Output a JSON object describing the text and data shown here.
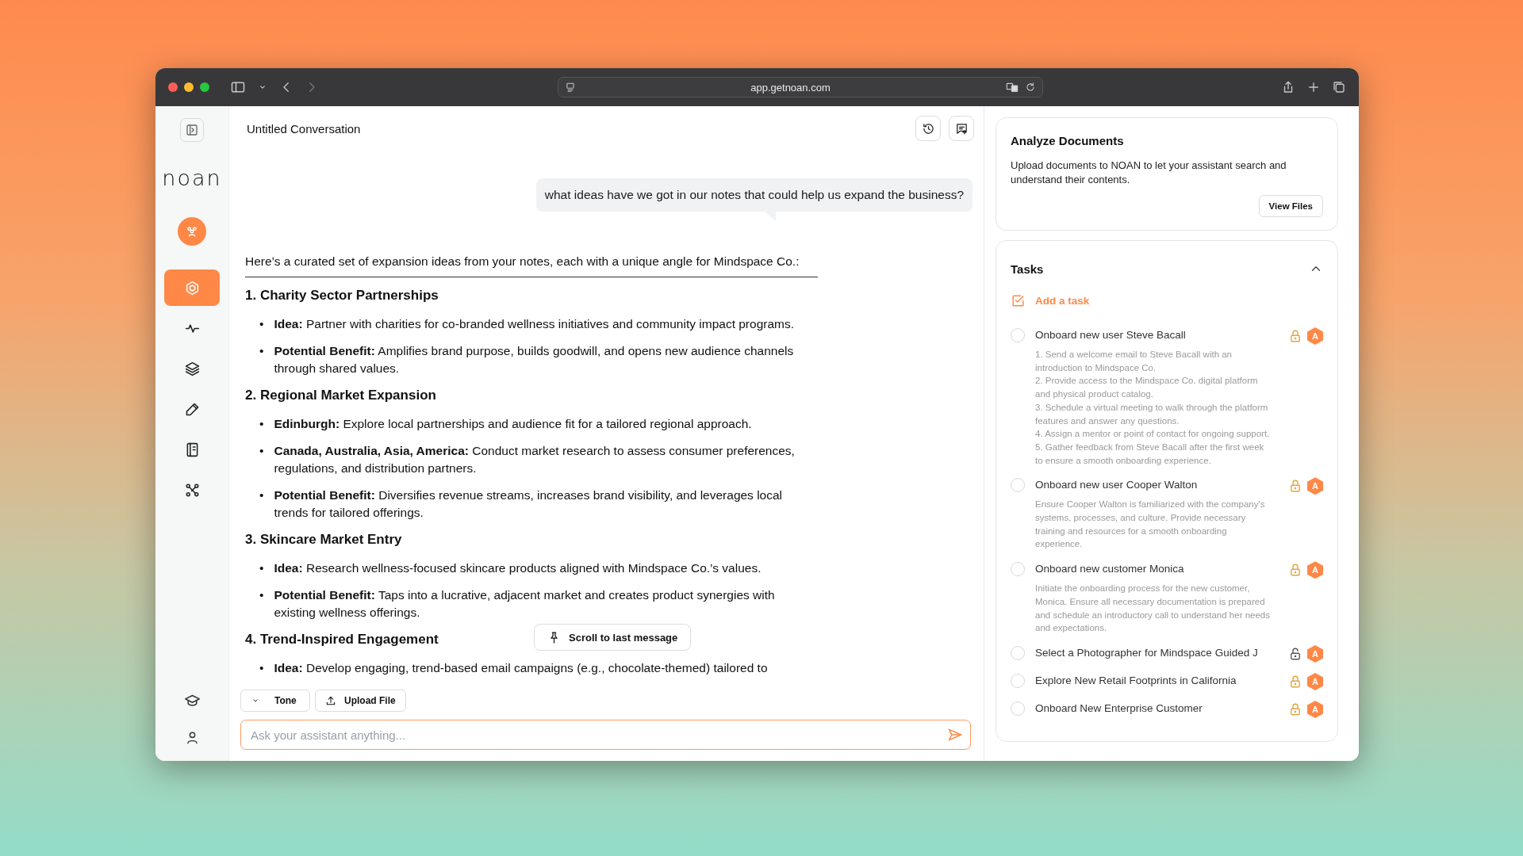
{
  "browser": {
    "url": "app.getnoan.com"
  },
  "sidebar": {
    "logo": "noan",
    "nav": [
      {
        "selected": true
      },
      {
        "selected": false
      },
      {
        "selected": false
      },
      {
        "selected": false
      },
      {
        "selected": false
      },
      {
        "selected": false
      }
    ]
  },
  "conversation": {
    "title": "Untitled Conversation",
    "user_message": "what ideas have we got in our notes that could help us expand the business?",
    "intro": "Here’s a curated set of expansion ideas from your notes, each with a unique angle for Mindspace Co.:",
    "sections": [
      {
        "heading": "1. Charity Sector Partnerships",
        "bullets": [
          {
            "marker": "•",
            "label": "Idea:",
            "text": "Partner with charities for co-branded wellness initiatives and community impact programs."
          },
          {
            "marker": "•",
            "label": "Potential Benefit:",
            "text": "Amplifies brand purpose, builds goodwill, and opens new audience channels through shared values."
          }
        ]
      },
      {
        "heading": "2. Regional Market Expansion",
        "bullets": [
          {
            "marker": "•",
            "label": "Edinburgh:",
            "text": "Explore local partnerships and audience fit for a tailored regional approach."
          },
          {
            "marker": "•",
            "label": "Canada, Australia, Asia, America:",
            "text": "Conduct market research to assess consumer preferences, regulations, and distribution partners."
          },
          {
            "marker": "•",
            "label": "Potential Benefit:",
            "text": "Diversifies revenue streams, increases brand visibility, and leverages local trends for tailored offerings."
          }
        ]
      },
      {
        "heading": "3. Skincare Market Entry",
        "bullets": [
          {
            "marker": "•",
            "label": "Idea:",
            "text": "Research wellness-focused skincare products aligned with Mindspace Co.’s values."
          },
          {
            "marker": "•",
            "label": "Potential Benefit:",
            "text": "Taps into a lucrative, adjacent market and creates product synergies with existing wellness offerings."
          }
        ]
      },
      {
        "heading": "4. Trend-Inspired Engagement",
        "bullets": [
          {
            "marker": "•",
            "label": "Idea:",
            "text": "Develop engaging, trend-based email campaigns (e.g., chocolate-themed) tailored to"
          }
        ]
      }
    ],
    "scroll_button": "Scroll to last message",
    "tone_button": "Tone",
    "upload_button": "Upload File",
    "input": {
      "placeholder": "Ask your assistant anything..."
    }
  },
  "documents": {
    "title": "Analyze Documents",
    "description": "Upload documents to NOAN to let your assistant search and understand their contents.",
    "button": "View Files"
  },
  "tasks": {
    "title": "Tasks",
    "expanded": true,
    "add_label": "Add a task",
    "items": [
      {
        "title": "Onboard new user Steve Bacall",
        "checked": false,
        "locked": true,
        "badge": "A",
        "description": "1. Send a welcome email to Steve Bacall with an introduction to Mindspace Co.\n2. Provide access to the Mindspace Co. digital platform and physical product catalog.\n3. Schedule a virtual meeting to walk through the platform features and answer any questions.\n4. Assign a mentor or point of contact for ongoing support.\n5. Gather feedback from Steve Bacall after the first week to ensure a smooth onboarding experience."
      },
      {
        "title": "Onboard new user Cooper Walton",
        "checked": false,
        "locked": true,
        "badge": "A",
        "description": "Ensure Cooper Walton is familiarized with the company's systems, processes, and culture. Provide necessary training and resources for a smooth onboarding experience."
      },
      {
        "title": "Onboard new customer Monica",
        "checked": false,
        "locked": true,
        "badge": "A",
        "description": "Initiate the onboarding process for the new customer, Monica. Ensure all necessary documentation is prepared and schedule an introductory call to understand her needs and expectations."
      },
      {
        "title": "Select a Photographer for Mindspace Guided J",
        "checked": false,
        "locked": false,
        "badge": "A"
      },
      {
        "title": "Explore New Retail Footprints in California",
        "checked": false,
        "locked": true,
        "badge": "A"
      },
      {
        "title": "Onboard New Enterprise Customer",
        "checked": false,
        "locked": true,
        "badge": "A"
      }
    ]
  }
}
